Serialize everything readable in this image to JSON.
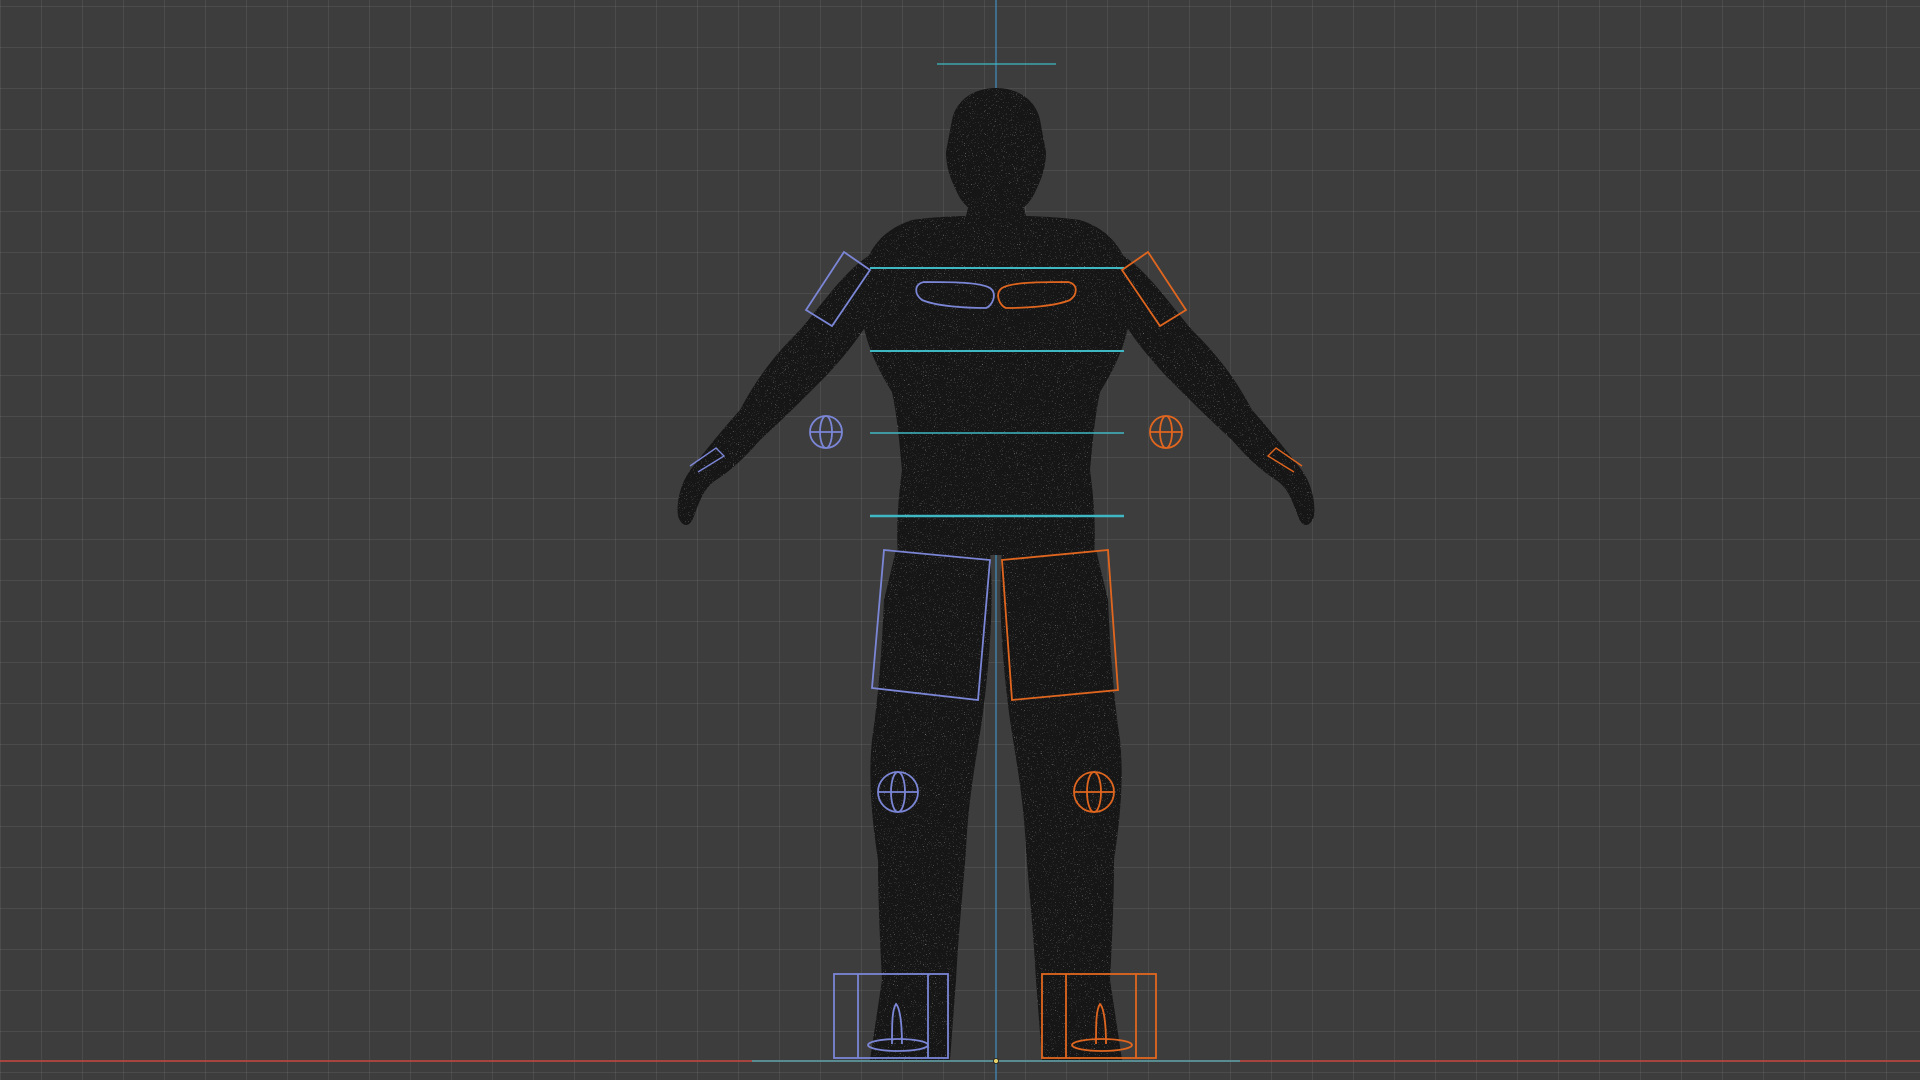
{
  "viewport": {
    "view": "front-orthographic",
    "object": "character-silhouette",
    "grid": true,
    "colors": {
      "background": "#3d3d3d",
      "grid_line": "#4a4a4a",
      "silhouette": "#141414",
      "x_axis": "#c8483e",
      "z_axis": "#3f8fbf",
      "center_control": "#3fb8c4",
      "left_control": "#7b86d6",
      "right_control": "#e0661f"
    },
    "icons": [
      "origin-point-icon"
    ]
  }
}
